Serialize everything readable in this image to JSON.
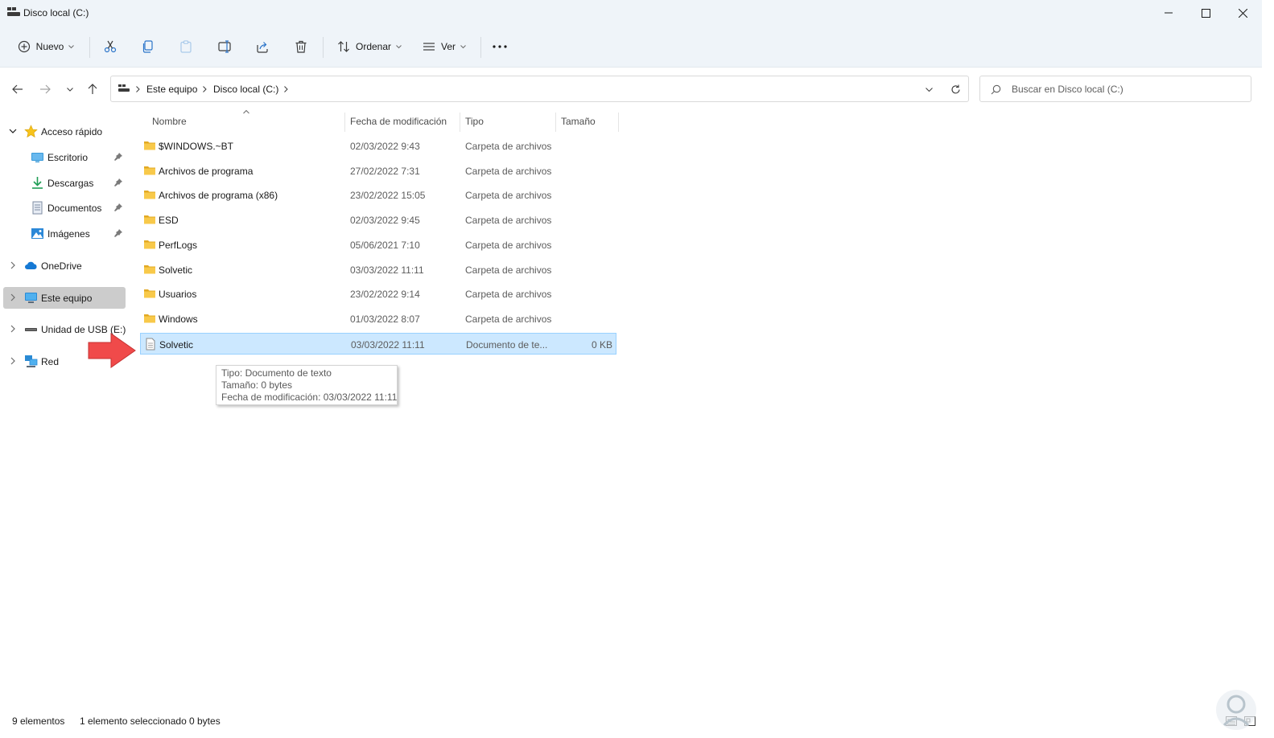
{
  "window": {
    "title": "Disco local (C:)"
  },
  "toolbar": {
    "new_label": "Nuevo",
    "sort_label": "Ordenar",
    "view_label": "Ver"
  },
  "address": {
    "crumbs": [
      "Este equipo",
      "Disco local (C:)"
    ]
  },
  "search": {
    "placeholder": "Buscar en Disco local (C:)"
  },
  "sidebar": {
    "items": [
      {
        "label": "Acceso rápido",
        "icon": "star-icon",
        "expanded": true
      },
      {
        "label": "Escritorio",
        "icon": "desktop-icon",
        "pinned": true
      },
      {
        "label": "Descargas",
        "icon": "download-icon",
        "pinned": true
      },
      {
        "label": "Documentos",
        "icon": "documents-icon",
        "pinned": true
      },
      {
        "label": "Imágenes",
        "icon": "pictures-icon",
        "pinned": true
      },
      {
        "label": "OneDrive",
        "icon": "cloud-icon"
      },
      {
        "label": "Este equipo",
        "icon": "computer-icon",
        "selected": true
      },
      {
        "label": "Unidad de USB (E:)",
        "icon": "usb-drive-icon"
      },
      {
        "label": "Red",
        "icon": "network-icon"
      }
    ]
  },
  "columns": {
    "name": "Nombre",
    "date": "Fecha de modificación",
    "type": "Tipo",
    "size": "Tamaño"
  },
  "files": [
    {
      "name": "$WINDOWS.~BT",
      "date": "02/03/2022 9:43",
      "type": "Carpeta de archivos",
      "size": "",
      "icon": "folder-icon"
    },
    {
      "name": "Archivos de programa",
      "date": "27/02/2022 7:31",
      "type": "Carpeta de archivos",
      "size": "",
      "icon": "folder-icon"
    },
    {
      "name": "Archivos de programa (x86)",
      "date": "23/02/2022 15:05",
      "type": "Carpeta de archivos",
      "size": "",
      "icon": "folder-icon"
    },
    {
      "name": "ESD",
      "date": "02/03/2022 9:45",
      "type": "Carpeta de archivos",
      "size": "",
      "icon": "folder-icon"
    },
    {
      "name": "PerfLogs",
      "date": "05/06/2021 7:10",
      "type": "Carpeta de archivos",
      "size": "",
      "icon": "folder-icon"
    },
    {
      "name": "Solvetic",
      "date": "03/03/2022 11:11",
      "type": "Carpeta de archivos",
      "size": "",
      "icon": "folder-icon"
    },
    {
      "name": "Usuarios",
      "date": "23/02/2022 9:14",
      "type": "Carpeta de archivos",
      "size": "",
      "icon": "folder-icon"
    },
    {
      "name": "Windows",
      "date": "01/03/2022 8:07",
      "type": "Carpeta de archivos",
      "size": "",
      "icon": "folder-icon"
    },
    {
      "name": "Solvetic",
      "date": "03/03/2022 11:11",
      "type": "Documento de te...",
      "size": "0 KB",
      "icon": "text-file-icon",
      "selected": true
    }
  ],
  "tooltip": {
    "line1": "Tipo: Documento de texto",
    "line2": "Tamaño: 0 bytes",
    "line3": "Fecha de modificación: 03/03/2022 11:11"
  },
  "status": {
    "count": "9 elementos",
    "selection": "1 elemento seleccionado",
    "size": "0 bytes"
  },
  "colors": {
    "chrome_bg": "#eff4f9",
    "selection_bg": "#cce8ff",
    "selection_border": "#99d1ff",
    "folder": "#f8c94a",
    "annotation_arrow": "#f04a4a"
  }
}
